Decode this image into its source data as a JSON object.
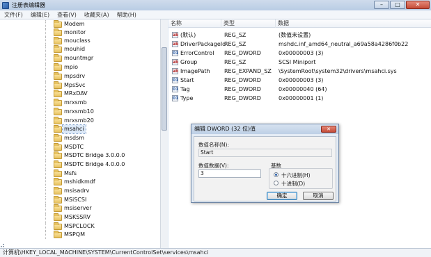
{
  "window": {
    "title": "注册表编辑器"
  },
  "window_buttons": {
    "minimize": "–",
    "maximize": "□",
    "close": "✕"
  },
  "menu": [
    "文件(F)",
    "编辑(E)",
    "查看(V)",
    "收藏夹(A)",
    "帮助(H)"
  ],
  "tree": {
    "items": [
      "Modem",
      "monitor",
      "mouclass",
      "mouhid",
      "mountmgr",
      "mpio",
      "mpsdrv",
      "MpsSvc",
      "MRxDAV",
      "mrxsmb",
      "mrxsmb10",
      "mrxsmb20",
      "msahci",
      "msdsm",
      "MSDTC",
      "MSDTC Bridge 3.0.0.0",
      "MSDTC Bridge 4.0.0.0",
      "Msfs",
      "mshidkmdf",
      "msisadrv",
      "MSiSCSI",
      "msiserver",
      "MSKSSRV",
      "MSPCLOCK",
      "MSPQM"
    ],
    "selected": "msahci"
  },
  "list": {
    "headers": {
      "name": "名称",
      "type": "类型",
      "data": "数据"
    },
    "rows": [
      {
        "icon": "string-value-icon",
        "name": "(默认)",
        "type": "REG_SZ",
        "data": "(数值未设置)"
      },
      {
        "icon": "string-value-icon",
        "name": "DriverPackageId",
        "type": "REG_SZ",
        "data": "mshdc.inf_amd64_neutral_a69a58a4286f0b22"
      },
      {
        "icon": "binary-value-icon",
        "name": "ErrorControl",
        "type": "REG_DWORD",
        "data": "0x00000003 (3)"
      },
      {
        "icon": "string-value-icon",
        "name": "Group",
        "type": "REG_SZ",
        "data": "SCSI Miniport"
      },
      {
        "icon": "string-value-icon",
        "name": "ImagePath",
        "type": "REG_EXPAND_SZ",
        "data": "\\SystemRoot\\system32\\drivers\\msahci.sys"
      },
      {
        "icon": "binary-value-icon",
        "name": "Start",
        "type": "REG_DWORD",
        "data": "0x00000003 (3)"
      },
      {
        "icon": "binary-value-icon",
        "name": "Tag",
        "type": "REG_DWORD",
        "data": "0x00000040 (64)"
      },
      {
        "icon": "binary-value-icon",
        "name": "Type",
        "type": "REG_DWORD",
        "data": "0x00000001 (1)"
      }
    ]
  },
  "dialog": {
    "title": "编辑 DWORD (32 位)值",
    "close": "✕",
    "value_name_label": "数值名称(N):",
    "value_name": "Start",
    "value_data_label": "数值数据(V):",
    "value_data": "3",
    "base_label": "基数",
    "radio_hex": "十六进制(H)",
    "radio_dec": "十进制(D)",
    "base_selected": "hex",
    "ok": "确定",
    "cancel": "取消"
  },
  "statusbar": {
    "path": "计算机\\HKEY_LOCAL_MACHINE\\SYSTEM\\CurrentControlSet\\services\\msahci"
  },
  "colors": {
    "selection": "#dbe8f7",
    "titlebar": "#bed0e6",
    "close": "#c44b37"
  }
}
